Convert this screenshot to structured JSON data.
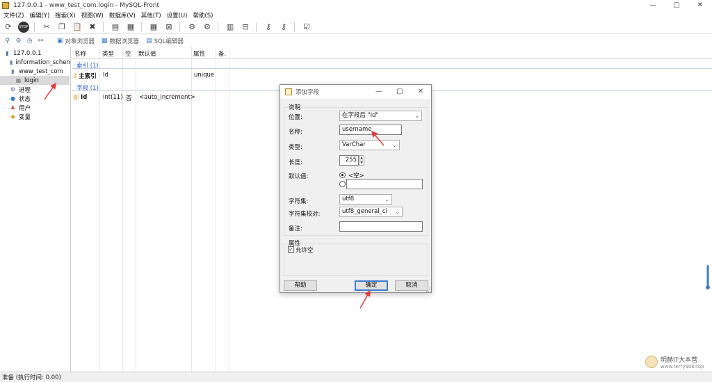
{
  "window": {
    "title": "127.0.0.1 - www_test_com.login - MySQL-Front",
    "controls": [
      "—",
      "▢",
      "✕"
    ]
  },
  "menu": [
    "文件(Z)",
    "编辑(Y)",
    "搜索(X)",
    "视图(W)",
    "数据库(V)",
    "其他(T)",
    "设置(U)",
    "帮助(S)"
  ],
  "toolbar_icons": [
    "refresh-icon",
    "stop-icon",
    "cut-icon",
    "copy-icon",
    "paste-icon",
    "delete-icon",
    "database-icon",
    "export-icon",
    "table-icon",
    "table-delete-icon",
    "link-icon",
    "link-edit-icon",
    "columns-icon",
    "columns-delete-icon",
    "key-icon",
    "key-edit-icon",
    "checklist-icon"
  ],
  "view_tabs": [
    "对象浏览器",
    "数据浏览器",
    "SQL编辑器"
  ],
  "tree": {
    "items": [
      {
        "label": "127.0.0.1",
        "icon": "server-icon",
        "level": 0
      },
      {
        "label": "information_schema",
        "icon": "database-icon",
        "level": 1
      },
      {
        "label": "www_test_com",
        "icon": "database-icon",
        "level": 1
      },
      {
        "label": "login",
        "icon": "table-icon",
        "level": 2,
        "selected": true
      },
      {
        "label": "进程",
        "icon": "process-icon",
        "level": 1
      },
      {
        "label": "状态",
        "icon": "status-icon",
        "level": 1
      },
      {
        "label": "用户",
        "icon": "users-icon",
        "level": 1
      },
      {
        "label": "变量",
        "icon": "variables-icon",
        "level": 1
      }
    ]
  },
  "grid": {
    "headers": [
      "名称",
      "类型",
      "空",
      "默认值",
      "属性",
      "备."
    ],
    "index_group": "索引 (1)",
    "index_row": {
      "name": "主索引",
      "type": "Id",
      "attr": "unique"
    },
    "field_group": "字段 (1)",
    "field_row": {
      "name": "Id",
      "type": "int(11)",
      "null": "否",
      "default": "<auto_increment>"
    }
  },
  "status": "准备 (执行时间: 0.00)",
  "dialog": {
    "title": "添加字段",
    "group_desc": "说明",
    "position_label": "位置:",
    "position_value": "在字段后 \"Id\"",
    "name_label": "名称:",
    "name_value": "username",
    "type_label": "类型:",
    "type_value": "VarChar",
    "length_label": "长度:",
    "length_value": "255",
    "default_label": "默认值:",
    "default_null": "<空>",
    "default_custom": "",
    "charset_label": "字符集:",
    "charset_value": "utf8",
    "collation_label": "字符集校对:",
    "collation_value": "utf8_general_ci",
    "comment_label": "备注:",
    "comment_value": "",
    "group_attr": "属性",
    "allow_null_label": "允许空",
    "allow_null_checked": true,
    "help_button": "帮助",
    "ok_button": "确定",
    "cancel_button": "取消"
  },
  "watermark": {
    "line1": "明赫IT大本营",
    "line2": "www.terry906.top"
  },
  "colors": {
    "accent": "#3a7bd5",
    "annotation_arrow": "#e53935",
    "group_label": "#2a5bd7"
  }
}
